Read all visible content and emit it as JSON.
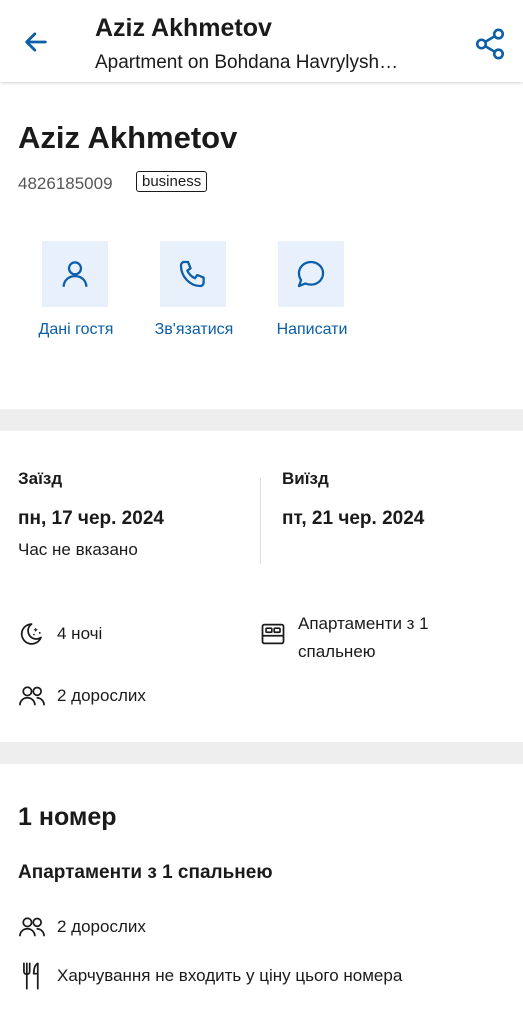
{
  "header": {
    "title": "Aziz Akhmetov",
    "subtitle": "Apartment on Bohdana Havrylysh…"
  },
  "guest": {
    "name": "Aziz Akhmetov",
    "phone": "4826185009",
    "badge": "business"
  },
  "actions": [
    {
      "label": "Дані гостя",
      "icon": "person-icon"
    },
    {
      "label": "Зв'язатися",
      "icon": "phone-icon"
    },
    {
      "label": "Написати",
      "icon": "chat-icon"
    }
  ],
  "stay": {
    "checkin_label": "Заїзд",
    "checkin_date": "пн, 17 чер. 2024",
    "checkin_time": "Час не вказано",
    "checkout_label": "Виїзд",
    "checkout_date": "пт, 21 чер. 2024",
    "nights": "4 ночі",
    "room_type": "Апартаменти з 1 спальнею",
    "guests": "2 дорослих"
  },
  "rooms": {
    "title": "1 номер",
    "room_name": "Апартаменти з 1 спальнею",
    "guests": "2 дорослих",
    "meals": "Харчування не входить у ціну цього номера"
  },
  "colors": {
    "accent": "#0b5ea8",
    "action_bg": "#e8f1fb",
    "separator": "#eeeeee"
  }
}
